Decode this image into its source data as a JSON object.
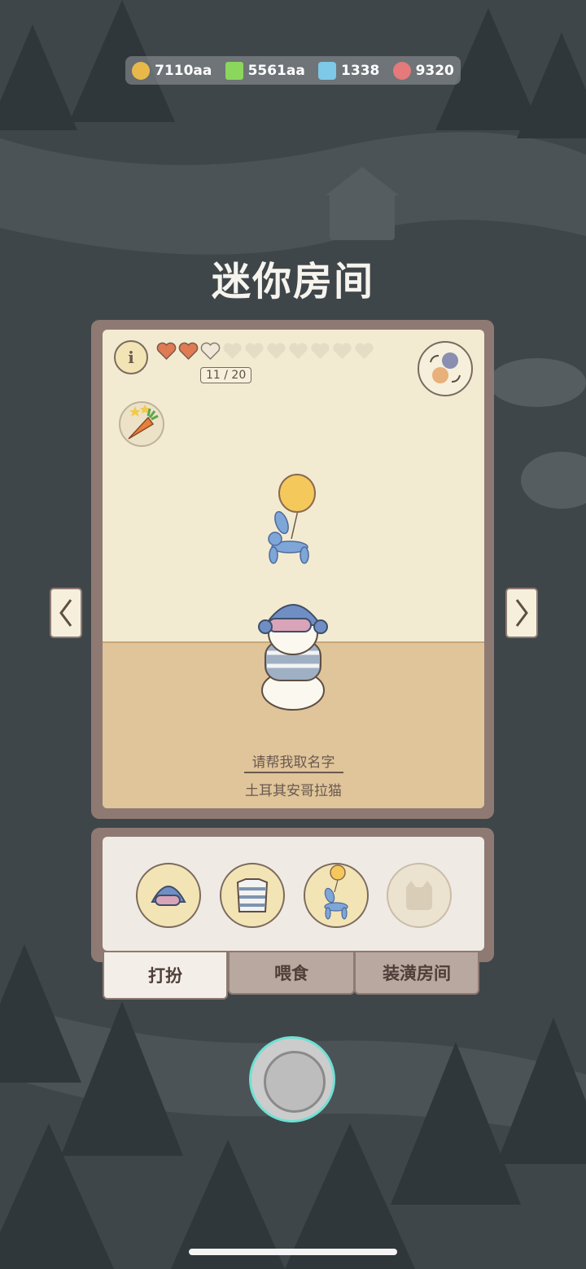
{
  "resources": [
    {
      "icon": "coin-icon",
      "value": "7110aa",
      "color": "#e8b94a"
    },
    {
      "icon": "energy-bolt-icon",
      "value": "5561aa",
      "color": "#8bd65c"
    },
    {
      "icon": "blue-gem-icon",
      "value": "1338",
      "color": "#7ec8e8"
    },
    {
      "icon": "fish-icon",
      "value": "9320",
      "color": "#e57a7a"
    }
  ],
  "title": "迷你房间",
  "room": {
    "hearts_filled": 2,
    "hearts_total": 10,
    "heart_count": "11 / 20",
    "name_prompt": "请帮我取名字",
    "breed": "土耳其安哥拉猫",
    "balloon_color": "#f5c85c"
  },
  "tabs": [
    {
      "label": "打扮",
      "active": true
    },
    {
      "label": "喂食",
      "active": false
    },
    {
      "label": "装潢房间",
      "active": false
    }
  ],
  "items": [
    {
      "icon": "helmet-icon"
    },
    {
      "icon": "striped-shirt-icon"
    },
    {
      "icon": "balloon-dog-icon"
    },
    {
      "icon": "empty-slot-icon"
    }
  ]
}
